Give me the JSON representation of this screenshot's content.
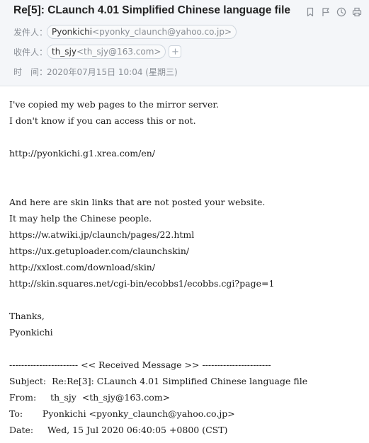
{
  "header": {
    "subject": "Re[5]: CLaunch 4.01 Simplified Chinese language file",
    "toolbar": {
      "icons": [
        "bookmark-icon",
        "flag-icon",
        "clock-icon",
        "print-icon"
      ]
    },
    "from": {
      "label": "发件人：",
      "name": "Pyonkichi",
      "address": "<pyonky_claunch@yahoo.co.jp>"
    },
    "to": {
      "label": "收件人：",
      "name": "th_sjy",
      "address": "<th_sjy@163.com>",
      "add_label": "+"
    },
    "time": {
      "label": "时　间：",
      "value": "2020年07月15日 10:04 (星期三)"
    }
  },
  "body": {
    "lines": [
      "I've copied my web pages to the mirror server.",
      "I don't know if you can access this or not.",
      "",
      "http://pyonkichi.g1.xrea.com/en/",
      "",
      "",
      "And here are skin links that are not posted your website.",
      "It may help the Chinese people.",
      "https://w.atwiki.jp/claunch/pages/22.html",
      "https://ux.getuploader.com/claunchskin/",
      "http://xxlost.com/download/skin/",
      "http://skin.squares.net/cgi-bin/ecobbs1/ecobbs.cgi?page=1",
      "",
      "Thanks,",
      "Pyonkichi",
      "",
      "----------------------- << Received Message >> -----------------------",
      "Subject:  Re:Re[3]: CLaunch 4.01 Simplified Chinese language file",
      "From:     th_sjy  <th_sjy@163.com>",
      "To:       Pyonkichi <pyonky_claunch@yahoo.co.jp>",
      "Date:     Wed, 15 Jul 2020 06:40:05 +0800 (CST)"
    ]
  },
  "colors": {
    "header_bg": "#f4f6f9",
    "subject": "#222222",
    "muted": "#8a8f96",
    "chip_border": "#cfd6de",
    "body_text": "#1a1a1a"
  }
}
